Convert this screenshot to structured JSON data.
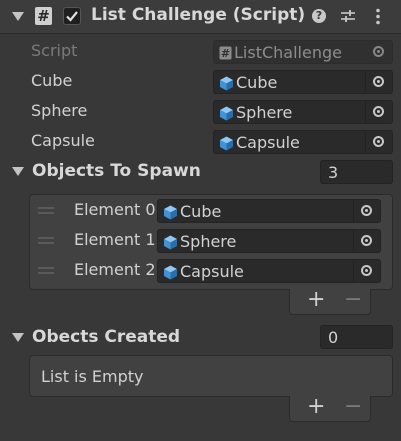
{
  "header": {
    "title": "List Challenge (Script)",
    "enabled": true
  },
  "fields": {
    "script": {
      "label": "Script",
      "value": "ListChallenge"
    },
    "cube": {
      "label": "Cube",
      "value": "Cube"
    },
    "sphere": {
      "label": "Sphere",
      "value": "Sphere"
    },
    "capsule": {
      "label": "Capsule",
      "value": "Capsule"
    }
  },
  "objects_to_spawn": {
    "title": "Objects To Spawn",
    "count": "3",
    "elements": [
      {
        "label": "Element 0",
        "value": "Cube"
      },
      {
        "label": "Element 1",
        "value": "Sphere"
      },
      {
        "label": "Element 2",
        "value": "Capsule"
      }
    ],
    "add_label": "+",
    "remove_label": "−"
  },
  "objects_created": {
    "title": "Obects Created",
    "count": "0",
    "empty_text": "List is Empty",
    "add_label": "+",
    "remove_label": "−"
  },
  "colors": {
    "background": "#383838",
    "field": "#2a2a2a",
    "cube_icon": "#4aa3e8"
  }
}
